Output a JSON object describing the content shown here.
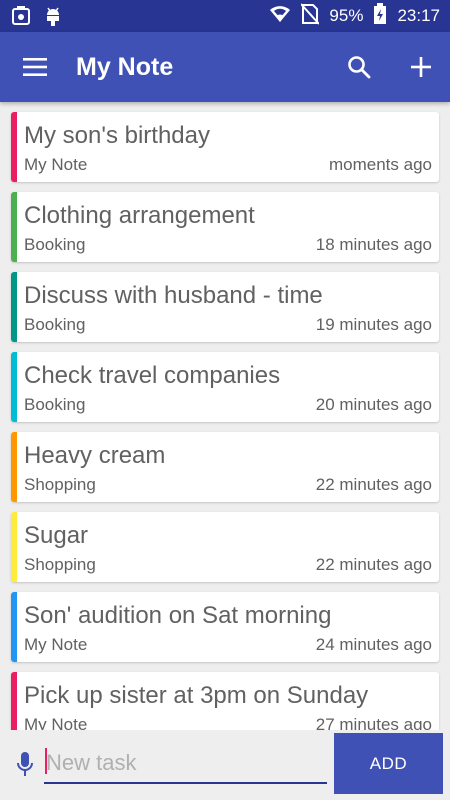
{
  "status_bar": {
    "battery": "95%",
    "time": "23:17",
    "icons": [
      "usb-debug-icon",
      "android-debug-icon",
      "wifi-icon",
      "no-sim-icon",
      "battery-charging-icon"
    ]
  },
  "app_bar": {
    "title": "My Note",
    "menu_icon": "hamburger-menu-icon",
    "search_icon": "search-icon",
    "add_icon": "plus-icon",
    "color": "#3f51b5",
    "status_color": "#283593"
  },
  "notes": [
    {
      "title": "My son's birthday",
      "category": "My Note",
      "time": "moments ago",
      "color": "#e91e63"
    },
    {
      "title": "Clothing arrangement",
      "category": "Booking",
      "time": "18 minutes ago",
      "color": "#4caf50"
    },
    {
      "title": "Discuss with husband - time",
      "category": "Booking",
      "time": "19 minutes ago",
      "color": "#009688"
    },
    {
      "title": "Check travel companies",
      "category": "Booking",
      "time": "20 minutes ago",
      "color": "#00bcd4"
    },
    {
      "title": "Heavy cream",
      "category": "Shopping",
      "time": "22 minutes ago",
      "color": "#ff9800"
    },
    {
      "title": "Sugar",
      "category": "Shopping",
      "time": "22 minutes ago",
      "color": "#ffeb3b"
    },
    {
      "title": "Son' audition on Sat morning",
      "category": "My Note",
      "time": "24 minutes ago",
      "color": "#2196f3"
    },
    {
      "title": "Pick up sister at 3pm on Sunday",
      "category": "My Note",
      "time": "27 minutes ago",
      "color": "#e91e63"
    }
  ],
  "input_bar": {
    "placeholder": "New task",
    "value": "",
    "add_label": "ADD",
    "mic_icon": "microphone-icon"
  }
}
